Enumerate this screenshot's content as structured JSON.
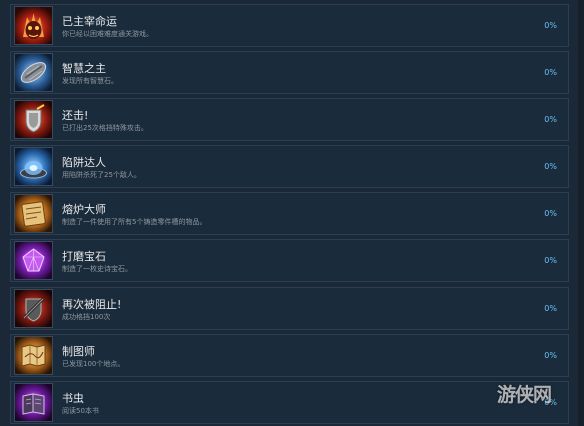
{
  "achievements": [
    {
      "title": "已主宰命运",
      "description": "你已经以困难难度通关游戏。",
      "percent": "0%",
      "icon": "flaming-demon-mask-icon",
      "color": "#d8382a"
    },
    {
      "title": "智慧之主",
      "description": "发现所有智慧石。",
      "percent": "0%",
      "icon": "wisdom-stone-icon",
      "color": "#6aa8e0"
    },
    {
      "title": "还击!",
      "description": "已打出25次格挡特殊攻击。",
      "percent": "0%",
      "icon": "shield-counter-icon",
      "color": "#d23a2a"
    },
    {
      "title": "陷阱达人",
      "description": "用陷阱杀死了25个敌人。",
      "percent": "0%",
      "icon": "trap-icon",
      "color": "#3f8fe0"
    },
    {
      "title": "熔炉大师",
      "description": "制造了一件使用了所有5个铸造零件槽的物品。",
      "percent": "0%",
      "icon": "forge-scroll-icon",
      "color": "#d6922a"
    },
    {
      "title": "打磨宝石",
      "description": "制造了一枚史诗宝石。",
      "percent": "0%",
      "icon": "purple-gem-icon",
      "color": "#a53ad8"
    },
    {
      "title": "再次被阻止!",
      "description": "成功格挡100次",
      "percent": "0%",
      "icon": "blocked-shield-icon",
      "color": "#c4382c"
    },
    {
      "title": "制图师",
      "description": "已发现100个地点。",
      "percent": "0%",
      "icon": "map-icon",
      "color": "#d6922a"
    },
    {
      "title": "书虫",
      "description": "阅读50本书",
      "percent": "0%",
      "icon": "book-icon",
      "color": "#a53ad8"
    }
  ],
  "watermark": {
    "text": "游侠网"
  }
}
